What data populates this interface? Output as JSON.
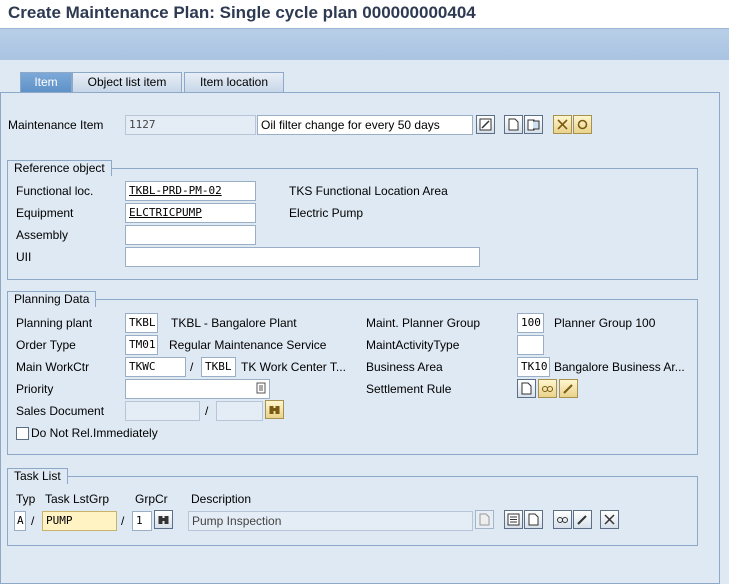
{
  "window": {
    "title": "Create Maintenance Plan: Single cycle plan 000000000404"
  },
  "tabs": [
    {
      "label": "Item",
      "active": true
    },
    {
      "label": "Object list item",
      "active": false
    },
    {
      "label": "Item location",
      "active": false
    }
  ],
  "item": {
    "label": "Maintenance Item",
    "number": "1127",
    "description": "Oil filter change for every 50 days"
  },
  "reference_object": {
    "title": "Reference object",
    "functional_loc": {
      "label": "Functional loc.",
      "value": "TKBL-PRD-PM-02",
      "text": "TKS Functional Location Area"
    },
    "equipment": {
      "label": "Equipment",
      "value": "ELCTRICPUMP",
      "text": "Electric Pump"
    },
    "assembly": {
      "label": "Assembly",
      "value": ""
    },
    "uii": {
      "label": "UII",
      "value": ""
    }
  },
  "planning_data": {
    "title": "Planning Data",
    "planning_plant": {
      "label": "Planning plant",
      "value": "TKBL",
      "text": "TKBL - Bangalore Plant"
    },
    "order_type": {
      "label": "Order Type",
      "value": "TM01",
      "text": "Regular Maintenance Service"
    },
    "main_workctr": {
      "label": "Main WorkCtr",
      "value": "TKWC",
      "sep": "/",
      "plant": "TKBL",
      "text": "TK Work Center T..."
    },
    "priority": {
      "label": "Priority",
      "value": ""
    },
    "sales_document": {
      "label": "Sales Document",
      "value": "",
      "sep": "/",
      "item": ""
    },
    "do_not_rel": {
      "label": "Do Not Rel.Immediately",
      "checked": false
    },
    "planner_group": {
      "label": "Maint. Planner Group",
      "value": "100",
      "text": "Planner Group 100"
    },
    "activity_type": {
      "label": "MaintActivityType",
      "value": ""
    },
    "business_area": {
      "label": "Business Area",
      "value": "TK10",
      "text": "Bangalore Business Ar..."
    },
    "settlement_rule": {
      "label": "Settlement Rule"
    }
  },
  "task_list": {
    "title": "Task List",
    "col_typ": "Typ",
    "col_grp": "Task LstGrp",
    "col_grpcr": "GrpCr",
    "col_desc": "Description",
    "typ": "A",
    "sep1": "/",
    "group": "PUMP",
    "sep2": "/",
    "counter": "1",
    "description": "Pump Inspection"
  },
  "colors": {
    "background": "#dfe9f3",
    "toolbar": "#b0c9e5",
    "active_tab": "#6b9dd0",
    "title_text": "#2e3a52"
  }
}
